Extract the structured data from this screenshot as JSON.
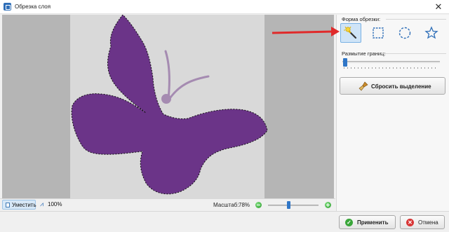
{
  "window": {
    "title": "Обрезка слоя",
    "close_icon": "close-icon"
  },
  "shape_panel": {
    "label": "Форма обрезки:",
    "tools": [
      {
        "name": "magic-wand",
        "icon": "magic-wand-icon",
        "selected": true
      },
      {
        "name": "rectangle",
        "icon": "rectangle-select-icon",
        "selected": false
      },
      {
        "name": "ellipse",
        "icon": "ellipse-select-icon",
        "selected": false
      },
      {
        "name": "star",
        "icon": "star-select-icon",
        "selected": false
      }
    ]
  },
  "blur": {
    "label": "Размытие границ:",
    "value": 0.0
  },
  "reset_button": {
    "label": "Сбросить выделение",
    "icon": "brush-icon"
  },
  "statusbar": {
    "fit_label": "Уместить",
    "zoom100_label": "100%",
    "scale_label": "Масштаб:",
    "scale_value": "78%",
    "zoom_slider_fraction": 0.4
  },
  "footer": {
    "apply_label": "Применить",
    "cancel_label": "Отмена"
  },
  "colors": {
    "butterfly": "#6b3488",
    "butterfly_antenna": "#a58bb1",
    "accent": "#2f76c7",
    "arrow": "#e02a2a"
  }
}
